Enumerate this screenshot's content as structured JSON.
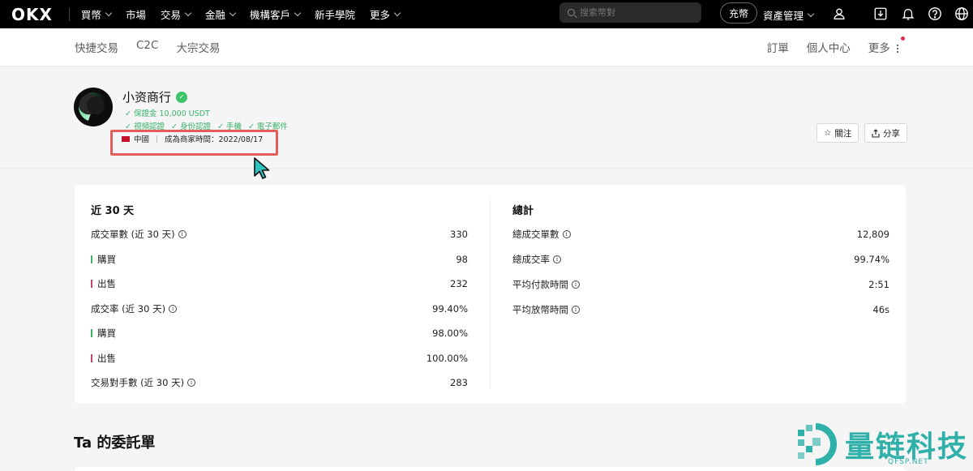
{
  "topnav": {
    "logo": "OKX",
    "items": [
      {
        "label": "買幣",
        "dropdown": true
      },
      {
        "label": "市場",
        "dropdown": false
      },
      {
        "label": "交易",
        "dropdown": true
      },
      {
        "label": "金融",
        "dropdown": true
      },
      {
        "label": "機構客戶",
        "dropdown": true
      },
      {
        "label": "新手學院",
        "dropdown": false
      },
      {
        "label": "更多",
        "dropdown": true
      }
    ],
    "search_placeholder": "搜索幣對",
    "deposit_label": "充幣",
    "asset_label": "資產管理"
  },
  "subnav": {
    "left": [
      "快捷交易",
      "C2C",
      "大宗交易"
    ],
    "right": [
      "訂單",
      "個人中心",
      "更多"
    ]
  },
  "profile": {
    "name": "小资商行",
    "deposit": "✓ 保證金 10,000 USDT",
    "verifications": [
      "✓ 視頻認證",
      "✓ 身份認證",
      "✓ 手機",
      "✓ 電子郵件"
    ],
    "country": "中國",
    "merchant_since": "成為商家時間：2022/08/17",
    "follow_label": "關注",
    "share_label": "分享"
  },
  "stats": {
    "left_title": "近 30 天",
    "left_rows": [
      {
        "label": "成交單數 (近 30 天)",
        "value": "330",
        "info": true,
        "bar": ""
      },
      {
        "label": "購買",
        "value": "98",
        "info": false,
        "bar": "green"
      },
      {
        "label": "出售",
        "value": "232",
        "info": false,
        "bar": "red"
      },
      {
        "label": "成交率 (近 30 天)",
        "value": "99.40%",
        "info": true,
        "bar": ""
      },
      {
        "label": "購買",
        "value": "98.00%",
        "info": false,
        "bar": "green"
      },
      {
        "label": "出售",
        "value": "100.00%",
        "info": false,
        "bar": "red"
      },
      {
        "label": "交易對手數 (近 30 天)",
        "value": "283",
        "info": true,
        "bar": ""
      }
    ],
    "right_title": "總計",
    "right_rows": [
      {
        "label": "總成交單數",
        "value": "12,809",
        "info": true
      },
      {
        "label": "總成交率",
        "value": "99.74%",
        "info": true
      },
      {
        "label": "平均付款時間",
        "value": "2:51",
        "info": true
      },
      {
        "label": "平均放幣時間",
        "value": "46s",
        "info": true
      }
    ]
  },
  "orders_title": "Ta 的委託單",
  "watermark": {
    "text": "量链科技",
    "url": "QFSP.NET"
  },
  "colors": {
    "accent_green": "#3bb36b",
    "sell_red": "#c8426a",
    "highlight": "#e35d5d",
    "watermark": "#2fb0a8"
  }
}
